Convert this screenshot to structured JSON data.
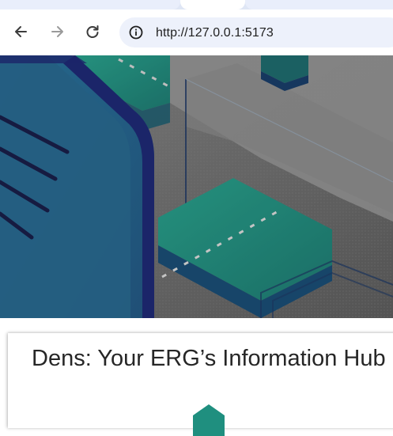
{
  "browser": {
    "url": "http://127.0.0.1:5173",
    "back_icon": "arrow-left-icon",
    "forward_icon": "arrow-right-icon",
    "reload_icon": "reload-icon",
    "info_icon": "info-icon"
  },
  "hero": {
    "image": "isometric-illustration"
  },
  "page": {
    "title": "Dens: Your ERG’s Information Hub"
  },
  "colors": {
    "teal": "#1f8f7f",
    "navy": "#1f2b78",
    "hero_grey": "#6b6b6b"
  }
}
